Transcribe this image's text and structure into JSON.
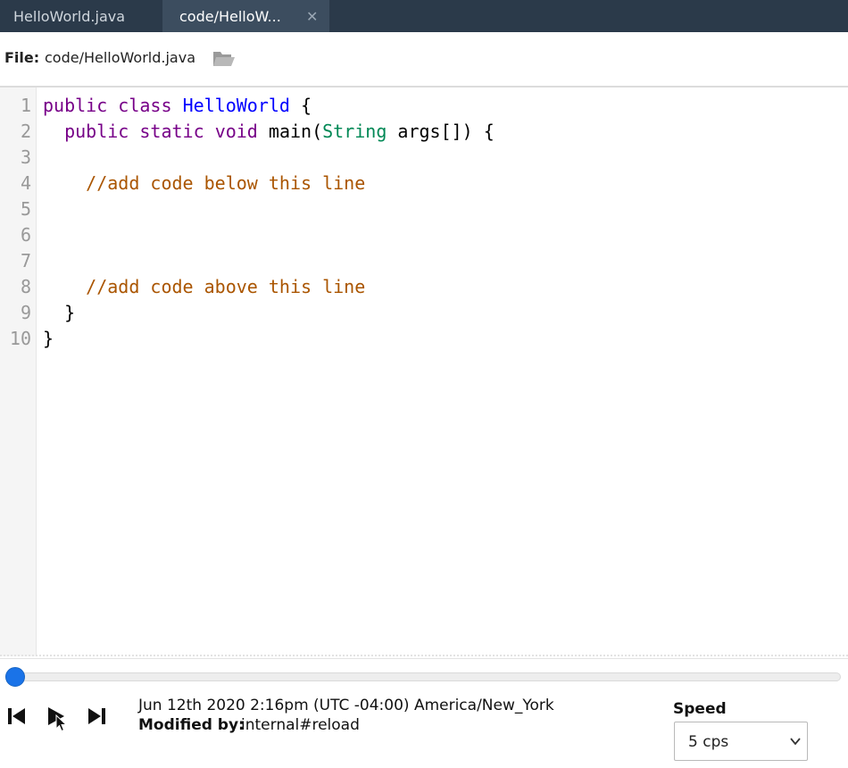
{
  "tabs": [
    {
      "label": "HelloWorld.java",
      "active": false
    },
    {
      "label": "code/HelloW...",
      "active": true,
      "close_glyph": "✕"
    }
  ],
  "filebar": {
    "label": "File:",
    "path": "code/HelloWorld.java",
    "icon": "folder-open-icon"
  },
  "editor": {
    "line_numbers": [
      "1",
      "2",
      "3",
      "4",
      "5",
      "6",
      "7",
      "8",
      "9",
      "10"
    ],
    "lines": [
      [
        {
          "t": "kw",
          "v": "public"
        },
        {
          "t": "var",
          "v": " "
        },
        {
          "t": "kw",
          "v": "class"
        },
        {
          "t": "var",
          "v": " "
        },
        {
          "t": "def",
          "v": "HelloWorld"
        },
        {
          "t": "var",
          "v": " {"
        }
      ],
      [
        {
          "t": "var",
          "v": "  "
        },
        {
          "t": "kw",
          "v": "public"
        },
        {
          "t": "var",
          "v": " "
        },
        {
          "t": "kw",
          "v": "static"
        },
        {
          "t": "var",
          "v": " "
        },
        {
          "t": "kw",
          "v": "void"
        },
        {
          "t": "var",
          "v": " main("
        },
        {
          "t": "type",
          "v": "String"
        },
        {
          "t": "var",
          "v": " args[]) {"
        }
      ],
      [],
      [
        {
          "t": "var",
          "v": "    "
        },
        {
          "t": "cm",
          "v": "//add code below this line"
        }
      ],
      [],
      [],
      [],
      [
        {
          "t": "var",
          "v": "    "
        },
        {
          "t": "cm",
          "v": "//add code above this line"
        }
      ],
      [
        {
          "t": "var",
          "v": "  }"
        }
      ],
      [
        {
          "t": "var",
          "v": "}"
        }
      ]
    ]
  },
  "playback": {
    "progress": 0,
    "timestamp": "Jun 12th 2020 2:16pm (UTC -04:00) America/New_York",
    "modified_label": "Modified by:",
    "modified_value": "internal#reload",
    "speed_label": "Speed",
    "speed_value": "5 cps",
    "icons": [
      "skip-back-icon",
      "play-icon",
      "skip-forward-icon"
    ]
  },
  "colors": {
    "tabbar_bg": "#2b3a4a",
    "accent": "#1a73e8",
    "keyword": "#770088",
    "definition": "#0000ff",
    "type": "#008855",
    "comment": "#aa5500"
  }
}
